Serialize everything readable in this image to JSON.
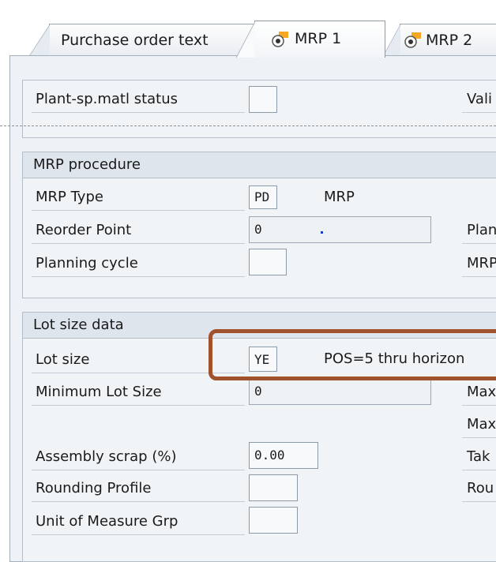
{
  "tabs": {
    "purchase_order_text": "Purchase order text",
    "mrp1": "MRP 1",
    "mrp2": "MRP 2"
  },
  "general": {
    "plant_sp_matl_status_label": "Plant-sp.matl status",
    "plant_sp_matl_status_value": "",
    "valid_from_label": "Vali"
  },
  "mrp_procedure": {
    "title": "MRP procedure",
    "mrp_type_label": "MRP Type",
    "mrp_type_value": "PD",
    "mrp_type_desc": "MRP",
    "reorder_point_label": "Reorder Point",
    "reorder_point_value": "0",
    "planning_cycle_label": "Planning cycle",
    "planning_cycle_value": "",
    "right_label_1": "Plan",
    "right_label_2": "MRP"
  },
  "lot_size_data": {
    "title": "Lot size data",
    "lot_size_label": "Lot size",
    "lot_size_value": "YE",
    "lot_size_desc": "POS=5 thru horizon",
    "min_lot_size_label": "Minimum Lot Size",
    "min_lot_size_value": "0",
    "assembly_scrap_label": "Assembly scrap (%)",
    "assembly_scrap_value": "0.00",
    "rounding_profile_label": "Rounding Profile",
    "rounding_profile_value": "",
    "uom_grp_label": "Unit of Measure Grp",
    "uom_grp_value": "",
    "right_label_1": "Max",
    "right_label_2": "Max",
    "right_label_3": "Tak",
    "right_label_4": "Rou"
  },
  "colors": {
    "highlight": "#a0522d",
    "tab_icon": "#f5a623"
  }
}
